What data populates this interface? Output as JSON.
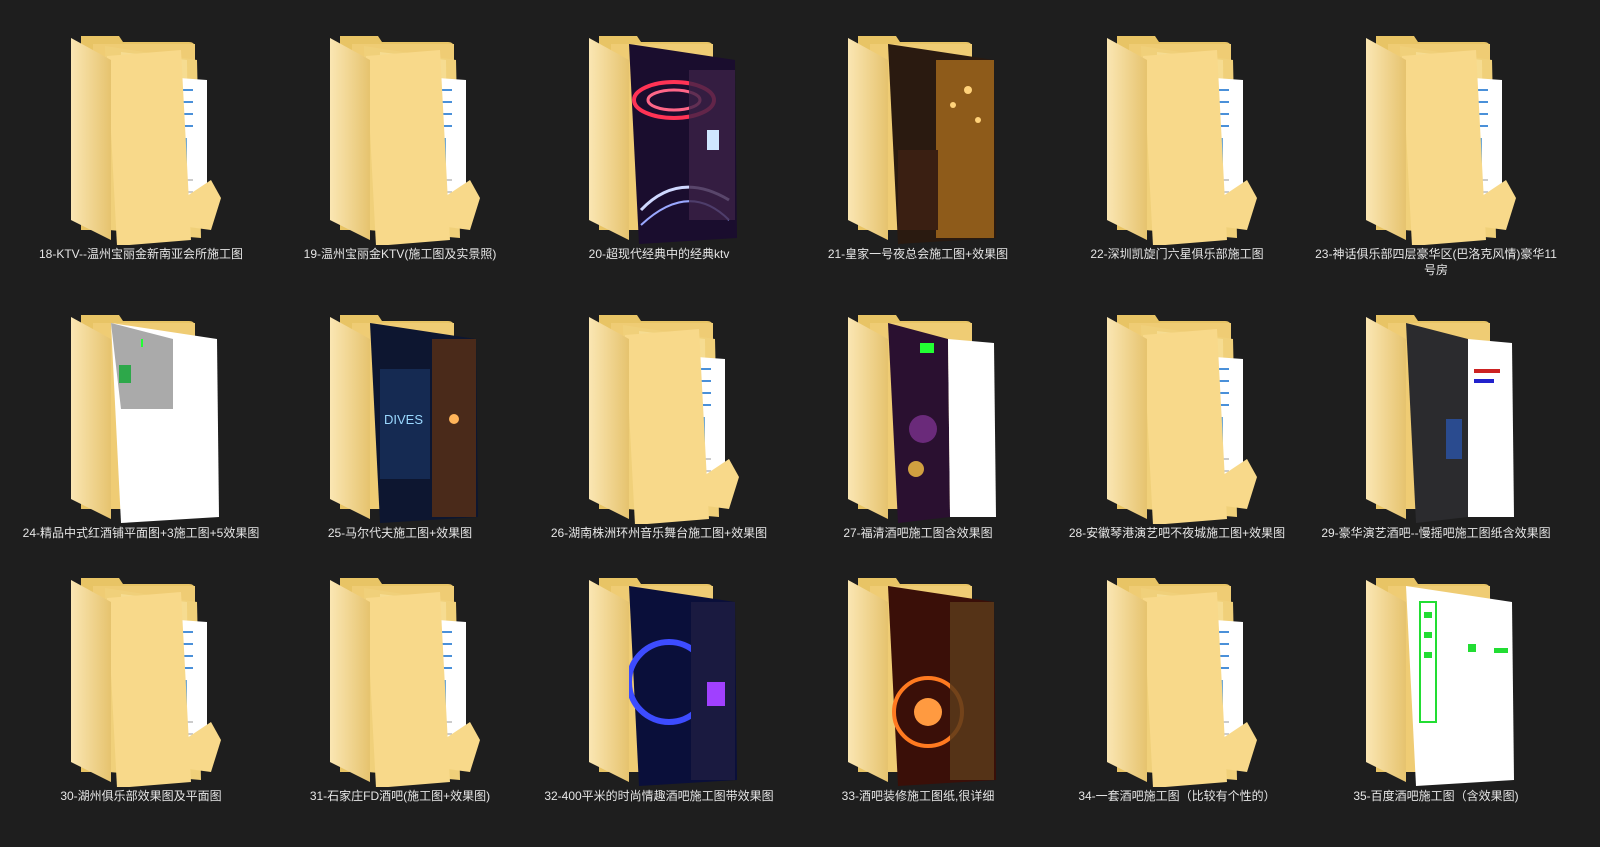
{
  "folders": [
    {
      "name": "18-KTV--温州宝丽金新南亚会所施工图",
      "preview": "doc"
    },
    {
      "name": "19-温州宝丽金KTV(施工图及实景照)",
      "preview": "doc"
    },
    {
      "name": "20-超现代经典中的经典ktv",
      "preview": "photo-neon"
    },
    {
      "name": "21-皇家一号夜总会施工图+效果图",
      "preview": "photo-warm"
    },
    {
      "name": "22-深圳凯旋门六星俱乐部施工图",
      "preview": "doc"
    },
    {
      "name": "23-神话俱乐部四层豪华区(巴洛克风情)豪华11号房",
      "preview": "doc"
    },
    {
      "name": "24-精品中式红酒铺平面图+3施工图+5效果图",
      "preview": "cad-plan"
    },
    {
      "name": "25-马尔代夫施工图+效果图",
      "preview": "photo-night"
    },
    {
      "name": "26-湖南株洲环州音乐舞台施工图+效果图",
      "preview": "doc"
    },
    {
      "name": "27-福清酒吧施工图含效果图",
      "preview": "photo-bar"
    },
    {
      "name": "28-安徽琴港演艺吧不夜城施工图+效果图",
      "preview": "doc"
    },
    {
      "name": "29-豪华演艺酒吧--慢摇吧施工图纸含效果图",
      "preview": "photo-corridor"
    },
    {
      "name": "30-湖州俱乐部效果图及平面图",
      "preview": "doc"
    },
    {
      "name": "31-石家庄FD酒吧(施工图+效果图)",
      "preview": "doc"
    },
    {
      "name": "32-400平米的时尚情趣酒吧施工图带效果图",
      "preview": "photo-blue"
    },
    {
      "name": "33-酒吧装修施工图纸,很详细",
      "preview": "photo-wheel"
    },
    {
      "name": "34-一套酒吧施工图（比较有个性的）",
      "preview": "doc"
    },
    {
      "name": "35-百度酒吧施工图（含效果图)",
      "preview": "cad-green"
    }
  ],
  "colors": {
    "background": "#1e1e1e",
    "label": "#e6e6e6",
    "folder_back": "#e8c465",
    "folder_front": "#f8d98a"
  }
}
